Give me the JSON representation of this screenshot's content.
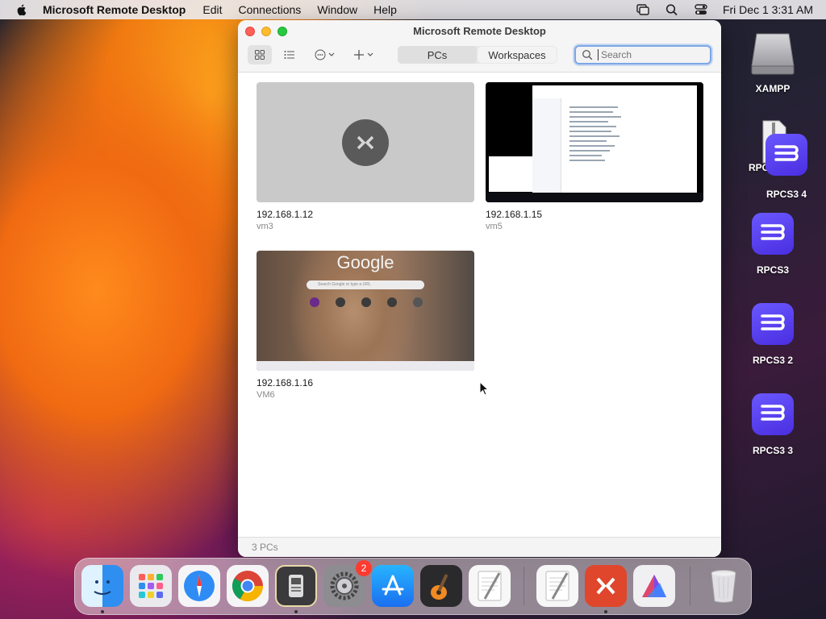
{
  "menubar": {
    "app_name": "Microsoft Remote Desktop",
    "menus": [
      "Edit",
      "Connections",
      "Window",
      "Help"
    ],
    "clock": "Fri Dec 1  3:31 AM"
  },
  "window": {
    "title": "Microsoft Remote Desktop",
    "segments": {
      "pcs": "PCs",
      "workspaces": "Workspaces"
    },
    "search_placeholder": "Search",
    "status": "3 PCs"
  },
  "pcs": [
    {
      "name": "192.168.1.12",
      "sub": "vm3",
      "thumbnail": "placeholder"
    },
    {
      "name": "192.168.1.15",
      "sub": "vm5",
      "thumbnail": "windows-explorer"
    },
    {
      "name": "192.168.1.16",
      "sub": "VM6",
      "thumbnail": "google-new-tab"
    }
  ],
  "google_thumb": {
    "logo": "Google",
    "search_text": "Search Google or type a URL"
  },
  "desktop": {
    "items": [
      {
        "label": "XAMPP",
        "icon": "drive-icon"
      },
      {
        "label": "RPCS3.zip",
        "icon": "zip-icon"
      },
      {
        "label": "RPCS3 4",
        "icon": "rpcs3-icon"
      },
      {
        "label": "RPCS3",
        "icon": "rpcs3-icon"
      },
      {
        "label": "RPCS3 2",
        "icon": "rpcs3-icon"
      },
      {
        "label": "RPCS3 3",
        "icon": "rpcs3-icon"
      }
    ]
  },
  "dock": {
    "apps": [
      "finder",
      "launchpad",
      "safari",
      "chrome",
      "system-information",
      "system-settings",
      "app-store",
      "garageband",
      "textedit",
      "textedit",
      "remote-desktop",
      "affinity",
      "trash"
    ],
    "settings_badge": "2"
  },
  "colors": {
    "accent": "#7aa7e6",
    "rpcs3": "#5a45f0",
    "remote_desktop": "#e0462b"
  }
}
